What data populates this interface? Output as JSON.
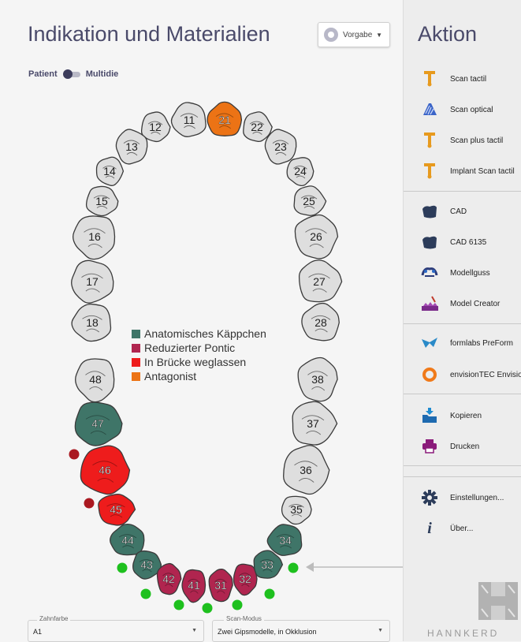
{
  "left_panel": {
    "title": "Indikation und Materialien",
    "preset_label": "Vorgabe",
    "toggle_left": "Patient",
    "toggle_right": "Multidie"
  },
  "colors": {
    "anatomic_cap": "#3f7568",
    "reduced_pontic": "#b0254f",
    "omit_in_bridge": "#ee1c1c",
    "antagonist": "#ec7315",
    "tooth_default": "#dedede",
    "marker_red": "#aa1820",
    "marker_green": "#1ec01e"
  },
  "legend": [
    {
      "label": "Anatomisches Käppchen",
      "color": "#3f7568"
    },
    {
      "label": "Reduzierter Pontic",
      "color": "#b0254f"
    },
    {
      "label": "In Brücke weglassen",
      "color": "#ee1c1c"
    },
    {
      "label": "Antagonist",
      "color": "#ec7315"
    }
  ],
  "teeth": [
    {
      "number": "11",
      "status": "none"
    },
    {
      "number": "12",
      "status": "none"
    },
    {
      "number": "13",
      "status": "none"
    },
    {
      "number": "14",
      "status": "none"
    },
    {
      "number": "15",
      "status": "none"
    },
    {
      "number": "16",
      "status": "none"
    },
    {
      "number": "17",
      "status": "none"
    },
    {
      "number": "18",
      "status": "none"
    },
    {
      "number": "21",
      "status": "antagonist"
    },
    {
      "number": "22",
      "status": "none"
    },
    {
      "number": "23",
      "status": "none"
    },
    {
      "number": "24",
      "status": "none"
    },
    {
      "number": "25",
      "status": "none"
    },
    {
      "number": "26",
      "status": "none"
    },
    {
      "number": "27",
      "status": "none"
    },
    {
      "number": "28",
      "status": "none"
    },
    {
      "number": "48",
      "status": "none"
    },
    {
      "number": "47",
      "status": "anatomic_cap"
    },
    {
      "number": "46",
      "status": "omit_in_bridge"
    },
    {
      "number": "45",
      "status": "omit_in_bridge"
    },
    {
      "number": "44",
      "status": "anatomic_cap"
    },
    {
      "number": "43",
      "status": "anatomic_cap"
    },
    {
      "number": "42",
      "status": "reduced_pontic"
    },
    {
      "number": "41",
      "status": "reduced_pontic"
    },
    {
      "number": "31",
      "status": "reduced_pontic"
    },
    {
      "number": "32",
      "status": "reduced_pontic"
    },
    {
      "number": "33",
      "status": "anatomic_cap"
    },
    {
      "number": "34",
      "status": "anatomic_cap"
    },
    {
      "number": "35",
      "status": "none"
    },
    {
      "number": "36",
      "status": "none"
    },
    {
      "number": "37",
      "status": "none"
    },
    {
      "number": "38",
      "status": "none"
    }
  ],
  "fields": {
    "shade_label": "Zahnfarbe",
    "shade_value": "A1",
    "scan_mode_label": "Scan-Modus",
    "scan_mode_value": "Zwei Gipsmodelle, in Okklusion"
  },
  "right_panel": {
    "title": "Aktion",
    "groups": [
      [
        {
          "label": "Scan tactil",
          "icon": "tactile-probe-icon"
        },
        {
          "label": "Scan optical",
          "icon": "optical-scan-icon"
        },
        {
          "label": "Scan plus tactil",
          "icon": "tactile-probe-icon"
        },
        {
          "label": "Implant Scan tactil",
          "icon": "tactile-probe-icon"
        }
      ],
      [
        {
          "label": "CAD",
          "icon": "cad-icon"
        },
        {
          "label": "CAD 6135",
          "icon": "cad-icon"
        },
        {
          "label": "Modellguss",
          "icon": "model-casting-icon"
        },
        {
          "label": "Model Creator",
          "icon": "model-creator-icon"
        }
      ],
      [
        {
          "label": "formlabs PreForm",
          "icon": "formlabs-icon"
        },
        {
          "label": "envisionTEC Envisio",
          "icon": "envisiontec-icon"
        }
      ],
      [
        {
          "label": "Kopieren",
          "icon": "copy-icon"
        },
        {
          "label": "Drucken",
          "icon": "print-icon"
        }
      ],
      [
        {
          "label": "Einstellungen...",
          "icon": "gear-icon"
        },
        {
          "label": "Über...",
          "icon": "info-icon"
        }
      ]
    ],
    "logo_text": "HANNKERD"
  }
}
